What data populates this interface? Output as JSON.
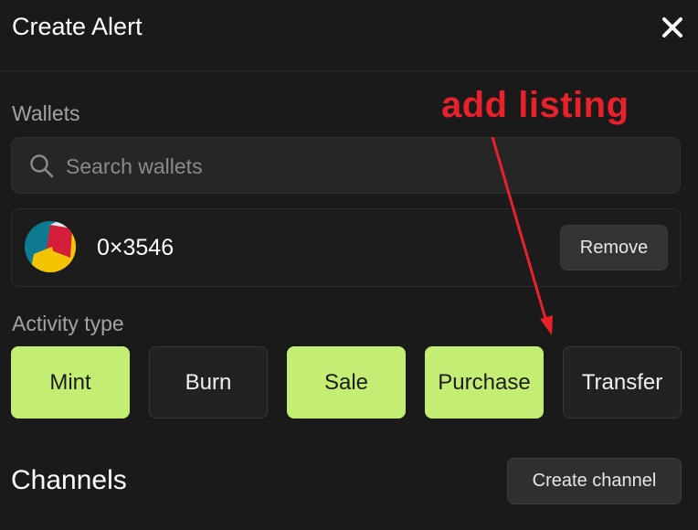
{
  "header": {
    "title": "Create Alert",
    "close_icon": "close-icon"
  },
  "wallets": {
    "label": "Wallets",
    "search": {
      "placeholder": "Search wallets",
      "value": "",
      "icon": "search-icon"
    },
    "items": [
      {
        "address": "0×3546",
        "avatar_colors": [
          "#0e7b93",
          "#d51f3a",
          "#f5c400"
        ],
        "remove_label": "Remove"
      }
    ]
  },
  "activity": {
    "label": "Activity type",
    "types": [
      {
        "label": "Mint",
        "selected": true
      },
      {
        "label": "Burn",
        "selected": false
      },
      {
        "label": "Sale",
        "selected": true
      },
      {
        "label": "Purchase",
        "selected": true
      },
      {
        "label": "Transfer",
        "selected": false
      }
    ],
    "selected_color": "#c3ed73"
  },
  "channels": {
    "title": "Channels",
    "create_label": "Create channel"
  },
  "annotation": {
    "text": "add listing",
    "color": "#e8212a"
  }
}
